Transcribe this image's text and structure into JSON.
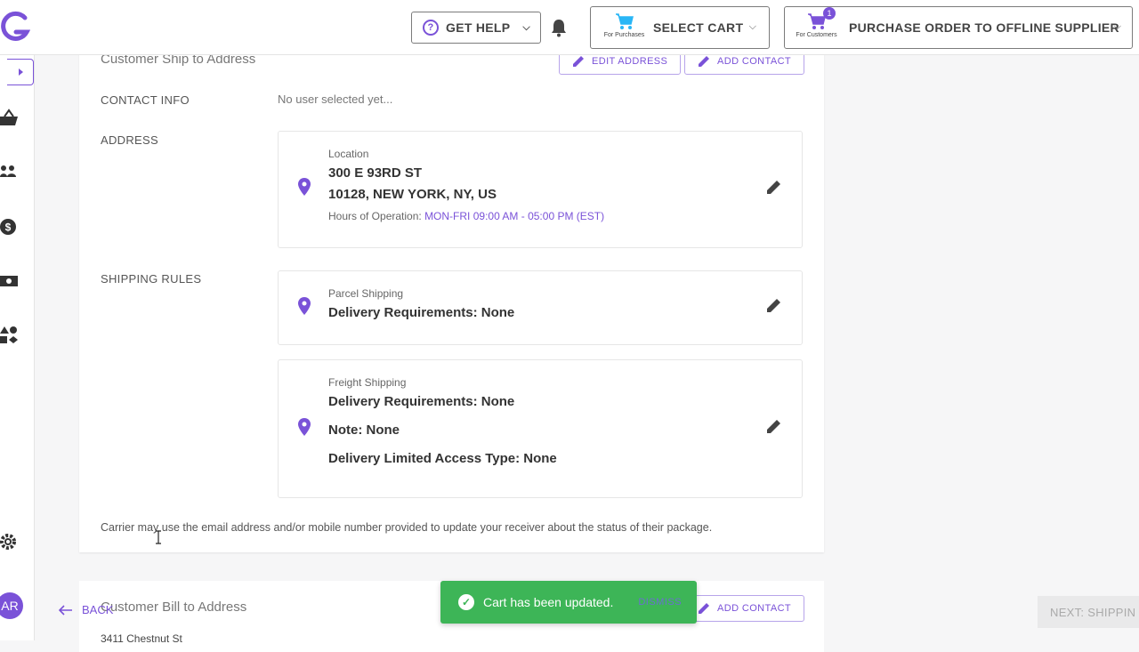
{
  "header": {
    "help_label": "GET HELP",
    "cart_label": "SELECT CART",
    "cart_sub": "For Purchases",
    "po_label": "PURCHASE ORDER TO OFFLINE SUPPLIER",
    "po_sub": "For Customers",
    "po_badge": "1",
    "icons": [
      "logo-icon",
      "help-icon",
      "bell-icon",
      "cart-icon",
      "chevron-down-icon"
    ]
  },
  "sidebar": {
    "icons": [
      "expand-icon",
      "basket-icon",
      "users-icon",
      "dollar-icon",
      "money-icon",
      "shapes-icon",
      "gear-icon"
    ],
    "avatar": "AR"
  },
  "ship_section": {
    "title": "Customer Ship to Address",
    "edit_address": "EDIT ADDRESS",
    "add_contact": "ADD CONTACT",
    "contact_label": "CONTACT INFO",
    "contact_value": "No user selected yet...",
    "address_label": "ADDRESS",
    "location_label": "Location",
    "street": "300 E 93RD ST",
    "city_line": "10128, NEW YORK, NY, US",
    "hours_label": "Hours of Operation:",
    "hours_value": "MON-FRI 09:00 AM - 05:00 PM (EST)",
    "shipping_rules_label": "SHIPPING RULES",
    "parcel": {
      "title": "Parcel Shipping",
      "requirements": "Delivery Requirements: None"
    },
    "freight": {
      "title": "Freight Shipping",
      "requirements": "Delivery Requirements: None",
      "note": "Note: None",
      "access": "Delivery Limited Access Type: None"
    },
    "carrier_note": "Carrier may use the email address and/or mobile number provided to update your receiver about the status of their package."
  },
  "bill_section": {
    "title": "Customer Bill to Address",
    "add_contact": "ADD CONTACT",
    "address_partial": "3411 Chestnut St"
  },
  "footer": {
    "back": "BACK",
    "next": "NEXT: SHIPPIN"
  },
  "toast": {
    "message": "Cart has been updated.",
    "dismiss": "DISMISS"
  },
  "colors": {
    "accent": "#7a52d8",
    "success": "#3db557"
  }
}
